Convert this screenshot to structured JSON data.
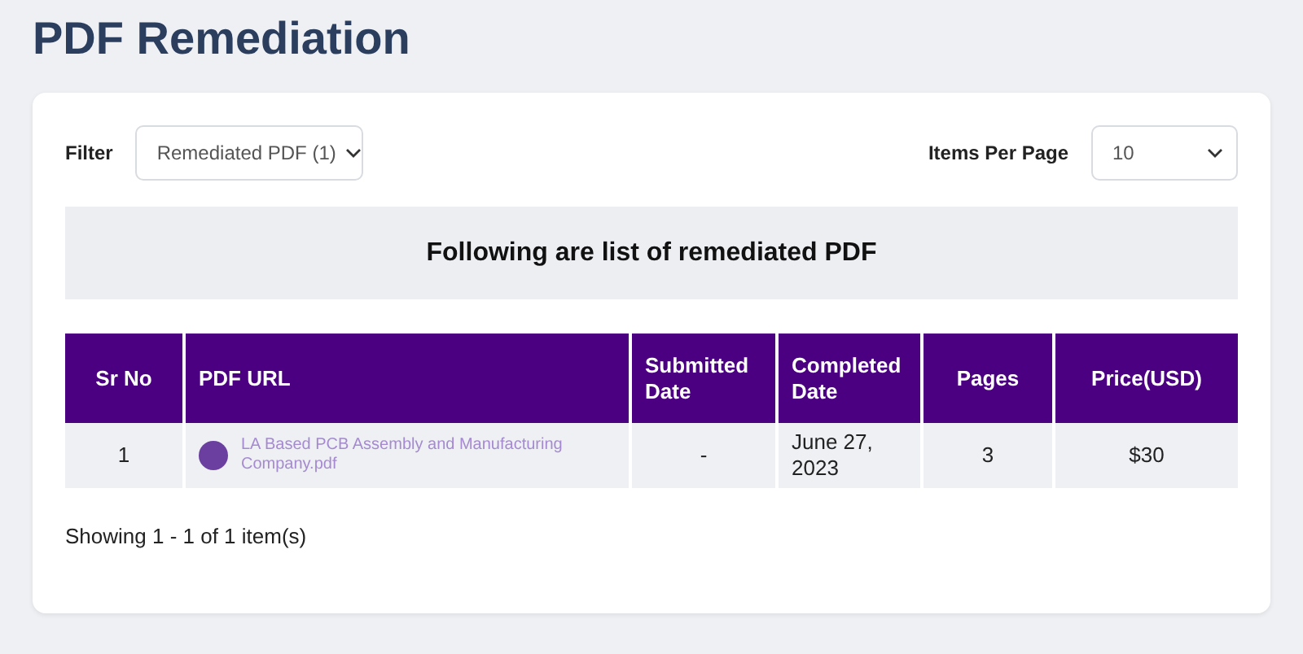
{
  "page_title": "PDF Remediation",
  "filter": {
    "label": "Filter",
    "value": "Remediated PDF (1)"
  },
  "items_per_page": {
    "label": "Items Per Page",
    "value": "10"
  },
  "banner": "Following are list of remediated PDF",
  "table": {
    "columns": [
      "Sr No",
      "PDF URL",
      "Submitted Date",
      "Completed Date",
      "Pages",
      "Price(USD)"
    ],
    "rows": [
      {
        "sr_no": "1",
        "pdf_url": "LA Based PCB Assembly and Manufacturing Company.pdf",
        "submitted_date": "-",
        "completed_date": "June 27, 2023",
        "pages": "3",
        "price": "$30"
      }
    ]
  },
  "summary": "Showing 1 - 1 of 1 item(s)"
}
